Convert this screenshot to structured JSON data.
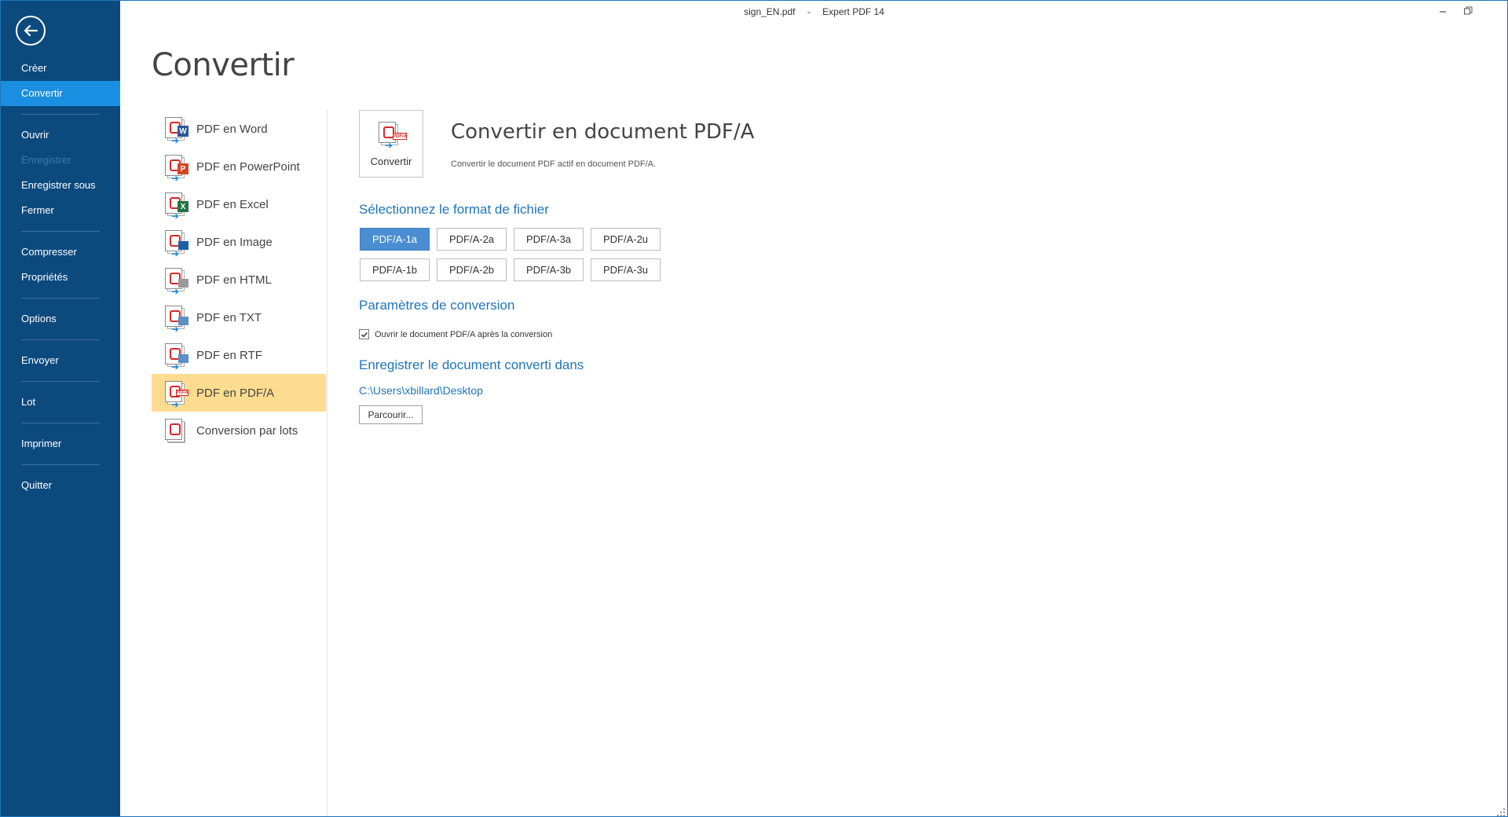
{
  "window": {
    "filename": "sign_EN.pdf",
    "separator": "-",
    "app_name": "Expert PDF 14"
  },
  "nav": {
    "items": [
      {
        "label": "Créer"
      },
      {
        "label": "Convertir"
      },
      {
        "label": "Ouvrir"
      },
      {
        "label": "Enregistrer"
      },
      {
        "label": "Enregistrer sous"
      },
      {
        "label": "Fermer"
      },
      {
        "label": "Compresser"
      },
      {
        "label": "Propriétés"
      },
      {
        "label": "Options"
      },
      {
        "label": "Envoyer"
      },
      {
        "label": "Lot"
      },
      {
        "label": "Imprimer"
      },
      {
        "label": "Quitter"
      }
    ],
    "active": "Convertir",
    "disabled": [
      "Enregistrer"
    ]
  },
  "page_title": "Convertir",
  "conversions": [
    {
      "label": "PDF en Word",
      "icon": "pdf-to-word-icon",
      "badge": "W",
      "badge_color": "#2b579a"
    },
    {
      "label": "PDF en PowerPoint",
      "icon": "pdf-to-powerpoint-icon",
      "badge": "P",
      "badge_color": "#d24726"
    },
    {
      "label": "PDF en Excel",
      "icon": "pdf-to-excel-icon",
      "badge": "X",
      "badge_color": "#217346"
    },
    {
      "label": "PDF en Image",
      "icon": "pdf-to-image-icon",
      "badge": "",
      "badge_color": "#1f5fa8"
    },
    {
      "label": "PDF en HTML",
      "icon": "pdf-to-html-icon",
      "badge": "",
      "badge_color": "#9a9a9a"
    },
    {
      "label": "PDF en TXT",
      "icon": "pdf-to-txt-icon",
      "badge": "",
      "badge_color": "#5b8fc7"
    },
    {
      "label": "PDF en RTF",
      "icon": "pdf-to-rtf-icon",
      "badge": "",
      "badge_color": "#5b8fc7"
    },
    {
      "label": "PDF en PDF/A",
      "icon": "pdf-to-pdfa-icon",
      "badge": "",
      "badge_color": "#d42a2a"
    },
    {
      "label": "Conversion par lots",
      "icon": "batch-conversion-icon",
      "badge": "",
      "badge_color": "#d42a2a"
    }
  ],
  "selected_conversion": "PDF en PDF/A",
  "panel": {
    "convert_button_label": "Convertir",
    "title": "Convertir en document PDF/A",
    "description": "Convertir le document PDF actif en document PDF/A.",
    "format_heading": "Sélectionnez le format de fichier",
    "formats": [
      "PDF/A-1a",
      "PDF/A-2a",
      "PDF/A-3a",
      "PDF/A-2u",
      "PDF/A-1b",
      "PDF/A-2b",
      "PDF/A-3b",
      "PDF/A-3u"
    ],
    "selected_format": "PDF/A-1a",
    "params_heading": "Paramètres de conversion",
    "open_after_label": "Ouvrir le document PDF/A après la conversion",
    "open_after_checked": true,
    "save_heading": "Enregistrer le document converti dans",
    "save_path": "C:\\Users\\xbillard\\Desktop",
    "browse_label": "Parcourir..."
  },
  "colors": {
    "nav_bg": "#0c4a7e",
    "nav_active": "#1a8ee0",
    "selection_bg": "#fedc8f",
    "accent": "#1d75bc",
    "format_selected": "#4a8ed1"
  }
}
